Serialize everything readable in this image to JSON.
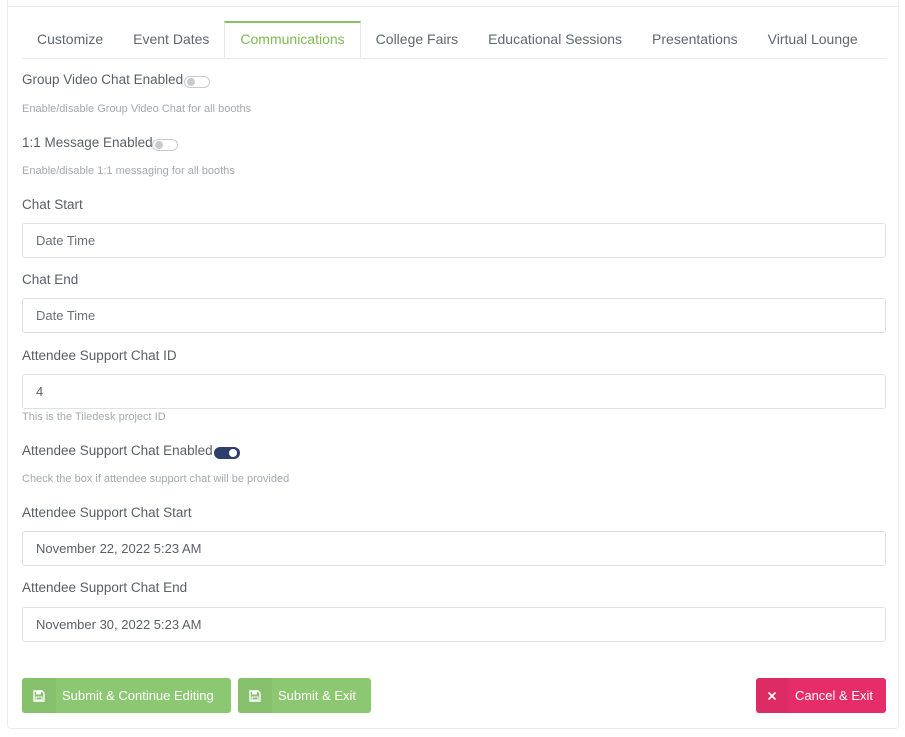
{
  "tabs": [
    {
      "label": "Customize",
      "active": false
    },
    {
      "label": "Event Dates",
      "active": false
    },
    {
      "label": "Communications",
      "active": true
    },
    {
      "label": "College Fairs",
      "active": false
    },
    {
      "label": "Educational Sessions",
      "active": false
    },
    {
      "label": "Presentations",
      "active": false
    },
    {
      "label": "Virtual Lounge",
      "active": false
    }
  ],
  "form": {
    "group_video": {
      "label": "Group Video Chat Enabled",
      "enabled": false,
      "help": "Enable/disable Group Video Chat for all booths"
    },
    "message": {
      "label": "1:1 Message Enabled",
      "enabled": false,
      "help": "Enable/disable 1:1 messaging for all booths"
    },
    "chat_start": {
      "label": "Chat Start",
      "value": "",
      "placeholder": "Date Time"
    },
    "chat_end": {
      "label": "Chat End",
      "value": "",
      "placeholder": "Date Time"
    },
    "support_chat_id": {
      "label": "Attendee Support Chat ID",
      "value": "4",
      "help": "This is the Tiledesk project ID"
    },
    "support_chat_enabled": {
      "label": "Attendee Support Chat Enabled",
      "enabled": true,
      "help": "Check the box if attendee support chat will be provided"
    },
    "support_chat_start": {
      "label": "Attendee Support Chat Start",
      "value": "November 22, 2022 5:23 AM"
    },
    "support_chat_end": {
      "label": "Attendee Support Chat End",
      "value": "November 30, 2022 5:23 AM"
    }
  },
  "buttons": {
    "submit_continue": {
      "label": "Submit & Continue Editing",
      "icon": "save-icon"
    },
    "submit_exit": {
      "label": "Submit & Exit",
      "icon": "save-icon"
    },
    "cancel_exit": {
      "label": "Cancel & Exit",
      "icon": "close-icon"
    }
  },
  "colors": {
    "accent_green": "#8cc871",
    "active_tab": "#7cbb53",
    "danger": "#e62d69",
    "toggle_on": "#2e3f6b"
  }
}
